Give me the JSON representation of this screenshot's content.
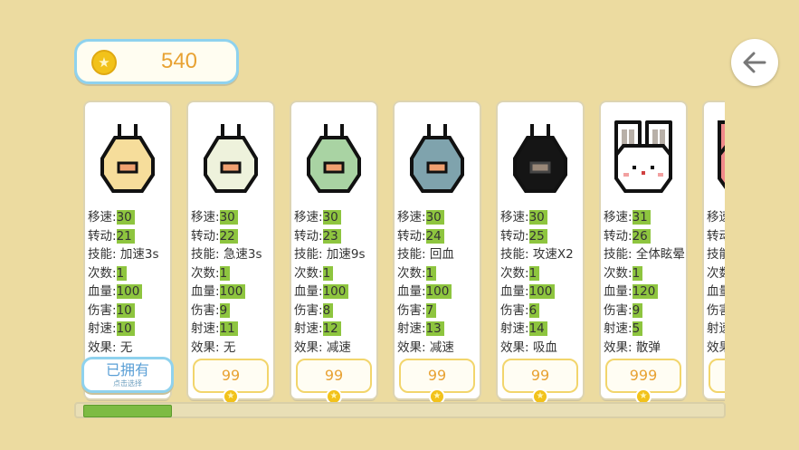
{
  "coins": {
    "count": "540",
    "icon": "star-coin-icon"
  },
  "back_button": {
    "icon": "arrow-left-icon"
  },
  "labels": {
    "move": "移速:",
    "turn": "转动:",
    "skill": "技能:",
    "uses": "次数:",
    "hp": "血量:",
    "damage": "伤害:",
    "fire_rate": "射速:",
    "effect": "效果:"
  },
  "characters": [
    {
      "name": "yellow-blob",
      "body": "#f6dd9b",
      "move": "30",
      "turn": "21",
      "skill": "加速3s",
      "uses": "1",
      "hp": "100",
      "damage": "10",
      "fire_rate": "10",
      "effect": "无",
      "owned": true,
      "owned_label": "已拥有",
      "owned_sub": "点击选择"
    },
    {
      "name": "cream-blob",
      "body": "#eef2dc",
      "move": "30",
      "turn": "22",
      "skill": "急速3s",
      "uses": "1",
      "hp": "100",
      "damage": "9",
      "fire_rate": "11",
      "effect": "无",
      "price": "99"
    },
    {
      "name": "green-blob",
      "body": "#a9d3a3",
      "move": "30",
      "turn": "23",
      "skill": "加速9s",
      "uses": "1",
      "hp": "100",
      "damage": "8",
      "fire_rate": "12",
      "effect": "减速",
      "price": "99"
    },
    {
      "name": "blue-blob",
      "body": "#7fa3ad",
      "move": "30",
      "turn": "24",
      "skill": "回血",
      "uses": "1",
      "hp": "100",
      "damage": "7",
      "fire_rate": "13",
      "effect": "减速",
      "price": "99"
    },
    {
      "name": "black-blob",
      "body": "#151515",
      "move": "30",
      "turn": "25",
      "skill": "攻速X2",
      "uses": "1",
      "hp": "100",
      "damage": "6",
      "fire_rate": "14",
      "effect": "吸血",
      "price": "99"
    },
    {
      "name": "white-bunny",
      "body": "#ffffff",
      "move": "31",
      "turn": "26",
      "skill": "全体眩晕",
      "uses": "1",
      "hp": "120",
      "damage": "9",
      "fire_rate": "5",
      "effect": "散弹",
      "price": "999"
    }
  ],
  "partial_card": {
    "body": "#f08a8a",
    "labels": [
      "移速",
      "转动",
      "技能",
      "次数",
      "血量",
      "伤害",
      "射速",
      "效果"
    ]
  },
  "scroll": {
    "position": 0.0
  }
}
